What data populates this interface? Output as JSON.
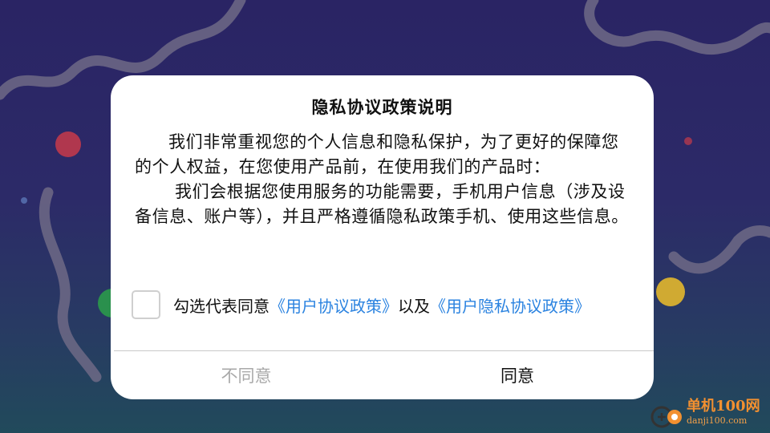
{
  "dialog": {
    "title": "隐私协议政策说明",
    "paragraph1": "我们非常重视您的个人信息和隐私保护，为了更好的保障您的个人权益，在您使用产品前，在使用我们的产品时：",
    "paragraph2": "我们会根据您使用服务的功能需要，手机用户信息（涉及设备信息、账户等），并且严格遵循隐私政策手机、使用这些信息。",
    "agree_prefix": "勾选代表同意",
    "link_user_agreement": "《用户协议政策》",
    "agree_middle": "以及",
    "link_privacy_policy": "《用户隐私协议政策》",
    "checkbox_checked": false,
    "disagree_label": "不同意",
    "agree_label": "同意"
  },
  "watermark": {
    "line1": "单机100网",
    "line2": "danji100.com"
  },
  "colors": {
    "link": "#2b83e0",
    "disagree_text": "#a9a9a9",
    "watermark": "#f29030"
  }
}
